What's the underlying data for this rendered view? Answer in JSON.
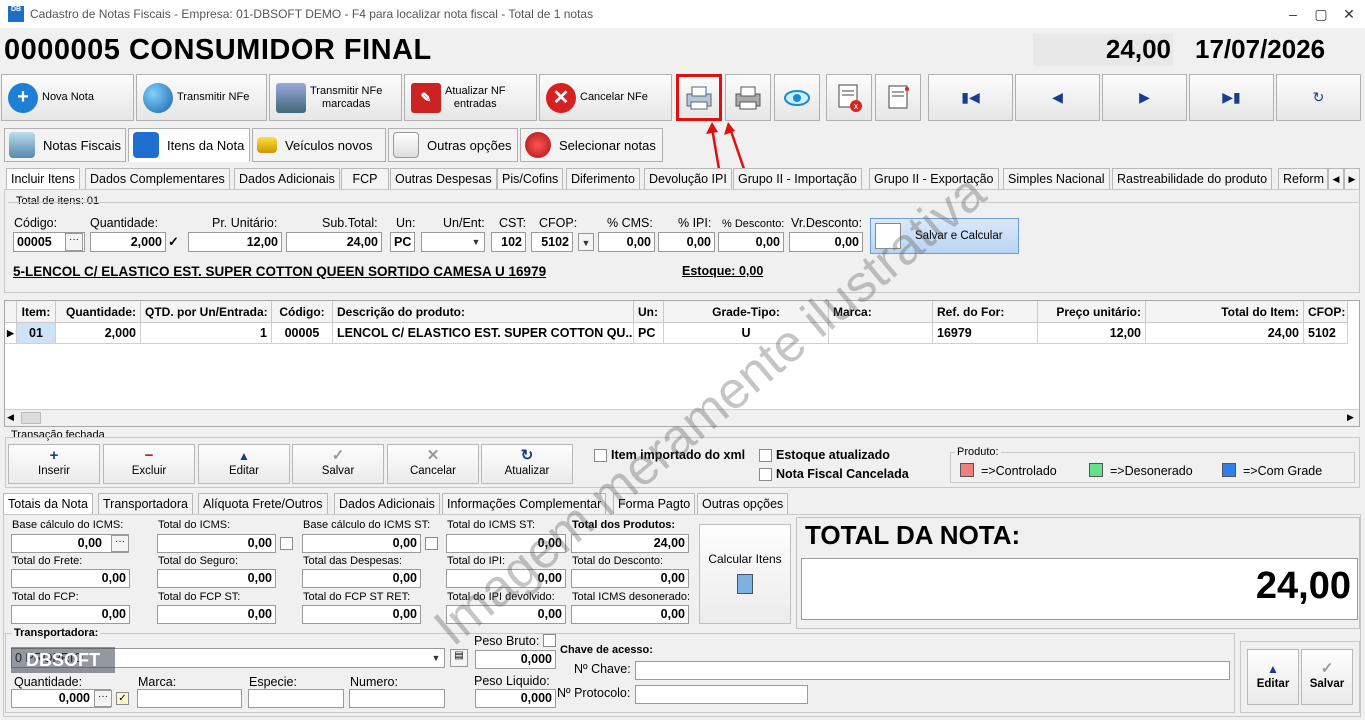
{
  "window": {
    "title": "Cadastro de Notas Fiscais - Empresa: 01-DBSOFT DEMO - F4 para localizar nota fiscal - Total de 1 notas",
    "app_icon": "DB"
  },
  "header": {
    "nota_title": "0000005 CONSUMIDOR FINAL",
    "total": "24,00",
    "date": "17/07/2026"
  },
  "toolbar": {
    "nova_nota": "Nova Nota",
    "transmitir": "Transmitir NFe",
    "transmitir_marcadas_1": "Transmitir NFe",
    "transmitir_marcadas_2": "marcadas",
    "atualizar_1": "Atualizar NF",
    "atualizar_2": "entradas",
    "cancelar": "Cancelar NFe"
  },
  "main_tabs": [
    "Notas Fiscais",
    "Itens da Nota",
    "Veículos novos",
    "Outras opções",
    "Selecionar notas"
  ],
  "sub_tabs": [
    "Incluir Itens",
    "Dados Complementares",
    "Dados Adicionais",
    "FCP",
    "Outras Despesas",
    "Pis/Cofins",
    "Diferimento",
    "Devolução IPI",
    "Grupo II - Importação",
    "Grupo II - Exportação",
    "Simples Nacional",
    "Rastreabilidade do produto",
    "Reform"
  ],
  "incluir": {
    "total_itens": "Total de itens: 01",
    "labels": {
      "codigo": "Código:",
      "quantidade": "Quantidade:",
      "pr_unitario": "Pr. Unitário:",
      "sub_total": "Sub.Total:",
      "un": "Un:",
      "un_ent": "Un/Ent:",
      "cst": "CST:",
      "cfop": "CFOP:",
      "p_cms": "% CMS:",
      "p_ipi": "% IPI:",
      "p_desconto": "% Desconto:",
      "vr_desconto": "Vr.Desconto:"
    },
    "values": {
      "codigo": "00005",
      "quantidade": "2,000",
      "pr_unitario": "12,00",
      "sub_total": "24,00",
      "un": "PC",
      "un_ent": "",
      "cst": "102",
      "cfop": "5102",
      "p_cms": "0,00",
      "p_ipi": "0,00",
      "p_desconto": "0,00",
      "vr_desconto": "0,00"
    },
    "salvar_calcular": "Salvar e Calcular",
    "produto_desc": "5-LENCOL C/ ELASTICO EST. SUPER COTTON QUEEN SORTIDO CAMESA U 16979",
    "estoque": "Estoque: 0,00"
  },
  "grid": {
    "headers": [
      "Item:",
      "Quantidade:",
      "QTD. por Un/Entrada:",
      "Código:",
      "Descrição do produto:",
      "Un:",
      "Grade-Tipo:",
      "Marca:",
      "Ref. do For:",
      "Preço unitário:",
      "Total do Item:",
      "CFOP:"
    ],
    "row": [
      "01",
      "2,000",
      "1",
      "00005",
      "LENCOL C/ ELASTICO EST. SUPER COTTON QU...",
      "PC",
      "U",
      "",
      "16979",
      "12,00",
      "24,00",
      "5102"
    ]
  },
  "actions": {
    "group_label": "Transação fechada",
    "inserir": "Inserir",
    "excluir": "Excluir",
    "editar": "Editar",
    "salvar": "Salvar",
    "cancelar": "Cancelar",
    "atualizar": "Atualizar",
    "item_importado": "Item importado do xml",
    "estoque_atualizado": "Estoque atualizado",
    "nf_cancelada": "Nota Fiscal Cancelada"
  },
  "legend": {
    "title": "Produto:",
    "items": [
      {
        "label": "=>Controlado",
        "color": "#f08080"
      },
      {
        "label": "=>Desonerado",
        "color": "#66e08a"
      },
      {
        "label": "=>Com Grade",
        "color": "#2f7fe8"
      }
    ]
  },
  "bottom_tabs": [
    "Totais da Nota",
    "Transportadora",
    "Alíquota Frete/Outros",
    "Dados Adicionais",
    "Informações Complementar",
    "Forma Pagto",
    "Outras opções"
  ],
  "totais": {
    "base_icms": {
      "label": "Base cálculo do ICMS:",
      "value": "0,00"
    },
    "total_icms": {
      "label": "Total do ICMS:",
      "value": "0,00"
    },
    "base_icms_st": {
      "label": "Base cálculo do ICMS ST:",
      "value": "0,00"
    },
    "total_icms_st": {
      "label": "Total do ICMS ST:",
      "value": "0,00"
    },
    "total_produtos": {
      "label": "Total dos Produtos:",
      "value": "24,00"
    },
    "total_frete": {
      "label": "Total do Frete:",
      "value": "0,00"
    },
    "total_seguro": {
      "label": "Total do Seguro:",
      "value": "0,00"
    },
    "total_despesas": {
      "label": "Total das Despesas:",
      "value": "0,00"
    },
    "total_ipi": {
      "label": "Total do IPI:",
      "value": "0,00"
    },
    "total_desconto": {
      "label": "Total do Desconto:",
      "value": "0,00"
    },
    "total_fcp": {
      "label": "Total do FCP:",
      "value": "0,00"
    },
    "total_fcp_st": {
      "label": "Total do FCP ST:",
      "value": "0,00"
    },
    "total_fcp_st_ret": {
      "label": "Total do FCP ST RET:",
      "value": "0,00"
    },
    "total_ipi_dev": {
      "label": "Total do IPI devolvido:",
      "value": "0,00"
    },
    "total_icms_des": {
      "label": "Total ICMS desonerado:",
      "value": "0,00"
    },
    "calcular_itens": "Calcular Itens",
    "total_nota_label": "TOTAL DA NOTA:",
    "total_nota": "24,00"
  },
  "transp": {
    "label": "Transportadora:",
    "value": "0 PROPRIO",
    "quantidade_label": "Quantidade:",
    "quantidade": "0,000",
    "marca_label": "Marca:",
    "especie_label": "Especie:",
    "numero_label": "Numero:",
    "peso_bruto_label": "Peso Bruto:",
    "peso_bruto": "0,000",
    "peso_liquido_label": "Peso Liquido:",
    "peso_liquido": "0,000",
    "chave_label": "Chave de acesso:",
    "n_chave": "Nº Chave:",
    "n_protocolo": "Nº Protocolo:",
    "editar": "Editar",
    "salvar": "Salvar"
  },
  "watermark": "Imagem meramente ilustrativa",
  "logo": "DBSOFT"
}
